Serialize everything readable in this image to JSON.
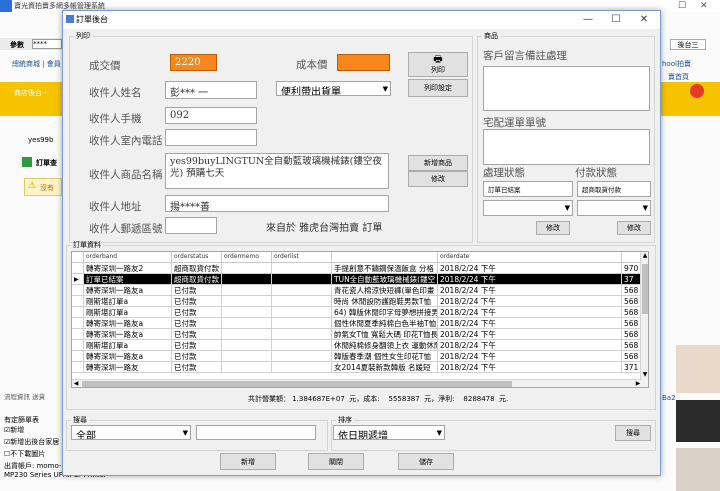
{
  "background": {
    "title": "寶光資拍賣多網多帳管理系統",
    "param_label": "參數",
    "param_value": "****",
    "tab_right": "後台三",
    "nav_left": "總統商城 | 會員",
    "nav_right_1": "hool拍賣",
    "nav_right_2": "賣首頁",
    "store_backend": "商店後台 -",
    "yes_label": "yes99b",
    "order_label": "訂單查",
    "warning_label": "沒有",
    "flow_label": "流程資訊 送貨",
    "bottom_title": "有定篩單表",
    "chk1": "新增",
    "chk2": "新增出後台家居",
    "chk3": "不下載圖片",
    "account": "出貨帳戶: momo-30",
    "printer": "MP230 Series UFRII LT Printer"
  },
  "dialog": {
    "title": "訂單後台",
    "min": "—",
    "max": "☐",
    "close": "✕",
    "group_print": "列印",
    "group_goods": "商品",
    "group_grid": "訂單資料",
    "group_search": "搜尋",
    "group_sort": "排序"
  },
  "form": {
    "deal_price_label": "成交價",
    "deal_price": "2220",
    "cost_label": "成本價",
    "cost": "",
    "recipient_name_label": "收件人姓名",
    "recipient_name": "彭*** 一",
    "shipping_method": "便利帶出貨單",
    "recipient_mobile_label": "收件人手機",
    "recipient_mobile": "092",
    "recipient_phone_label": "收件人室內電話",
    "recipient_phone": "",
    "product_name_label": "收件人商品名稱",
    "product_name": "yes99buyLINGTUN全自動藍玻璃機械錶(鏤空夜光) 預購七天",
    "address_label": "收件人地址",
    "address": "揚****善",
    "postal_label": "收件人郵遞區號",
    "postal": "",
    "source": "來自於 雅虎台灣拍賣 訂單"
  },
  "buttons": {
    "print": "列印",
    "print_setup": "列印設定",
    "add_goods": "新增商品",
    "edit": "修改",
    "edit_status": "修改",
    "edit_payment": "修改",
    "search": "搜尋",
    "add": "新增",
    "close": "關閉",
    "save": "儲存"
  },
  "right": {
    "customer_note_label": "客戶留言備註處理",
    "tracking_label": "宅配運單單號",
    "status_label": "處理狀態",
    "payment_label": "付款狀態",
    "status_value": "訂單已結案",
    "payment_value": "超商取貨付款"
  },
  "grid": {
    "headers": [
      "orderband",
      "orderstatus",
      "ordermemo",
      "orderlist",
      "",
      "orderdate",
      ""
    ],
    "rows": [
      {
        "band": "轉寄深圳一路友2",
        "status": "超商取貨付款",
        "list": "手提創意不鏽鋼保溫飯盒 分格",
        "date": "2018/2/24 下午",
        "num": "970"
      },
      {
        "band": "訂單已結案",
        "status": "超商取貨付款",
        "list": "TUN全自動藍玻璃機械錶(鏤空",
        "date": "2018/2/24 下午",
        "num": "37"
      },
      {
        "band": "轉寄深圳一路友a",
        "status": "已付款",
        "list": "青花瓷人棉涼快短褲(單色印畫",
        "date": "2018/2/24 下午",
        "num": "568"
      },
      {
        "band": "剛斯堪訂單a",
        "status": "已付款",
        "list": "時尚 休閒設防護跑鞋男款T恤",
        "date": "2018/2/24 下午",
        "num": "568"
      },
      {
        "band": "剛斯堪訂單a",
        "status": "已付款",
        "list": "64) 韓版休閒印字母夢想拼接男",
        "date": "2018/2/24 下午",
        "num": "568"
      },
      {
        "band": "轉寄深圳一路友a",
        "status": "已付款",
        "list": "個性休閒夏季純棉白色半袖T恤",
        "date": "2018/2/24 下午",
        "num": "568"
      },
      {
        "band": "轉寄深圳一路友a",
        "status": "已付款",
        "list": "帥氣女T恤 寬鬆大碼 印花T恤長",
        "date": "2018/2/24 下午",
        "num": "568"
      },
      {
        "band": "剛斯堪訂單a",
        "status": "已付款",
        "list": "休閒純棉修身翻領上衣 運動休閒",
        "date": "2018/2/24 下午",
        "num": "568"
      },
      {
        "band": "轉寄深圳一路友a",
        "status": "已付款",
        "list": "韓版春季潮 個性女生印花T恤",
        "date": "2018/2/24 下午",
        "num": "568"
      },
      {
        "band": "轉寄深圳一路友",
        "status": "已付款",
        "list": "女2014夏裝新款韓版 名媛短",
        "date": "2018/2/24 下午",
        "num": "371"
      }
    ],
    "summary": "共計營業額： 1.384687E+07  元，成本:    5558387  元，淨利:    8288478  元."
  },
  "search": {
    "field_value": "全部",
    "text_value": "",
    "sort_value": "依日期遞增"
  }
}
